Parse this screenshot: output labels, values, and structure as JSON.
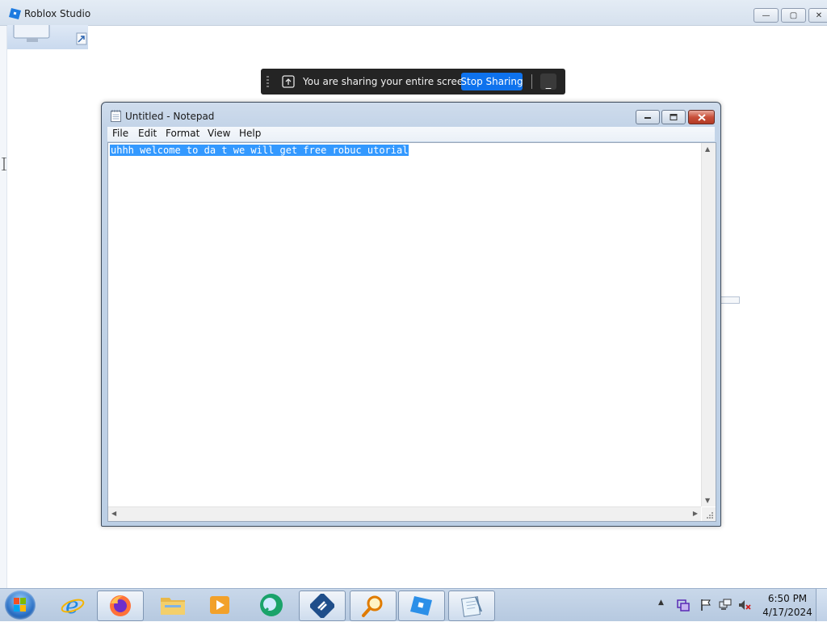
{
  "roblox_window": {
    "title": "Roblox Studio",
    "controls": {
      "minimize": "—",
      "maximize": "▢",
      "close": "✕"
    }
  },
  "share_bar": {
    "message": "You are sharing your entire screen.",
    "stop_label": "Stop Sharing",
    "minimize_label": "_"
  },
  "notepad": {
    "title": "Untitled - Notepad",
    "menu": [
      "File",
      "Edit",
      "Format",
      "View",
      "Help"
    ],
    "content": "uhhh welcome to da t we will get free robuc utorial"
  },
  "taskbar": {
    "apps": [
      "internet-explorer",
      "firefox",
      "file-explorer",
      "media-player",
      "teams-app",
      "installer-app",
      "search-app",
      "roblox-studio",
      "notepad"
    ],
    "clock": {
      "time": "6:50 PM",
      "date": "4/17/2024"
    }
  },
  "colors": {
    "selection": "#3399ff",
    "stop_sharing": "#0e72ed",
    "share_bar_bg": "#242424"
  }
}
